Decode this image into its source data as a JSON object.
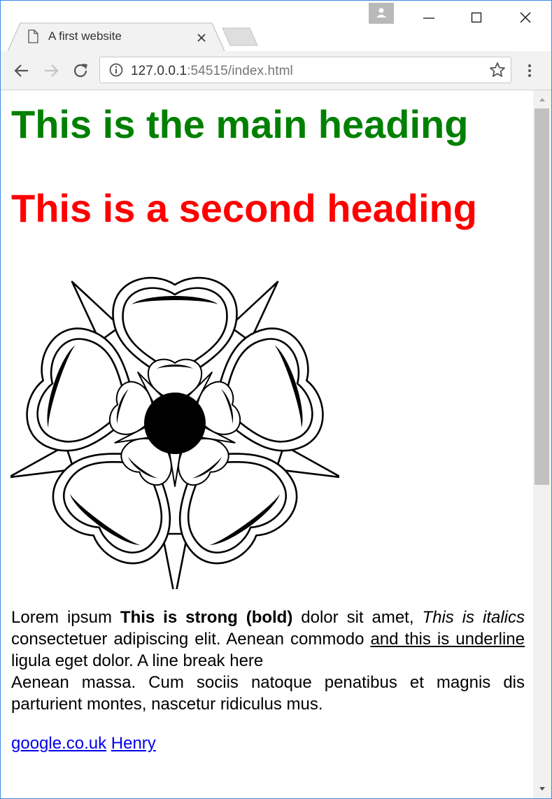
{
  "browser": {
    "tab_title": "A first website",
    "url_host": "127.0.0.1",
    "url_rest": ":54515/index.html"
  },
  "page": {
    "main_heading": "This is the main heading",
    "second_heading": "This is a second heading",
    "main_heading_color": "#008000",
    "second_heading_color": "#ff0000",
    "paragraph": {
      "t1": "Lorem ipsum ",
      "strong": "This is strong (bold)",
      "t2": " dolor sit amet, ",
      "italic": "This is italics",
      "t3": " consectetuer adipiscing elit. Aenean commodo ",
      "underline": "and this is underline ",
      "t4": "ligula eget dolor. A line break here",
      "t5": "Aenean massa. Cum sociis natoque penatibus et magnis dis parturient montes, nascetur ridiculus mus."
    },
    "links": [
      {
        "label": "google.co.uk"
      },
      {
        "label": "Henry"
      }
    ]
  },
  "colors": {
    "window_border": "#3c8de8",
    "link": "#0000ee"
  }
}
